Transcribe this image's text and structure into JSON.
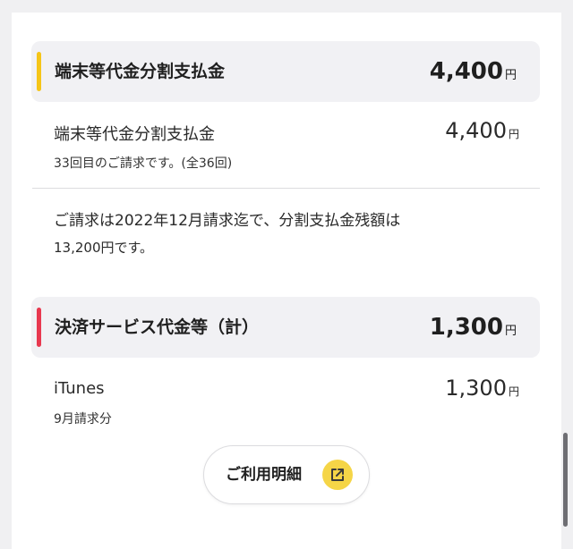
{
  "installment": {
    "header_title": "端末等代金分割支払金",
    "header_amount": "4,400",
    "header_unit": "円",
    "accent_color": "#f5c518",
    "item_name": "端末等代金分割支払金",
    "item_amount": "4,400",
    "item_unit": "円",
    "item_sub": "33回目のご請求です。(全36回)"
  },
  "note": {
    "line1": "ご請求は2022年12月請求迄で、分割支払金残額は",
    "line2": "13,200円です。"
  },
  "payment": {
    "header_title": "決済サービス代金等（計）",
    "header_amount": "1,300",
    "header_unit": "円",
    "accent_color": "#e8384f",
    "item_name": "iTunes",
    "item_amount": "1,300",
    "item_unit": "円",
    "item_sub": "9月請求分"
  },
  "detail_button": {
    "label": "ご利用明細",
    "icon": "external-link-icon",
    "icon_bg": "#f5d547"
  }
}
